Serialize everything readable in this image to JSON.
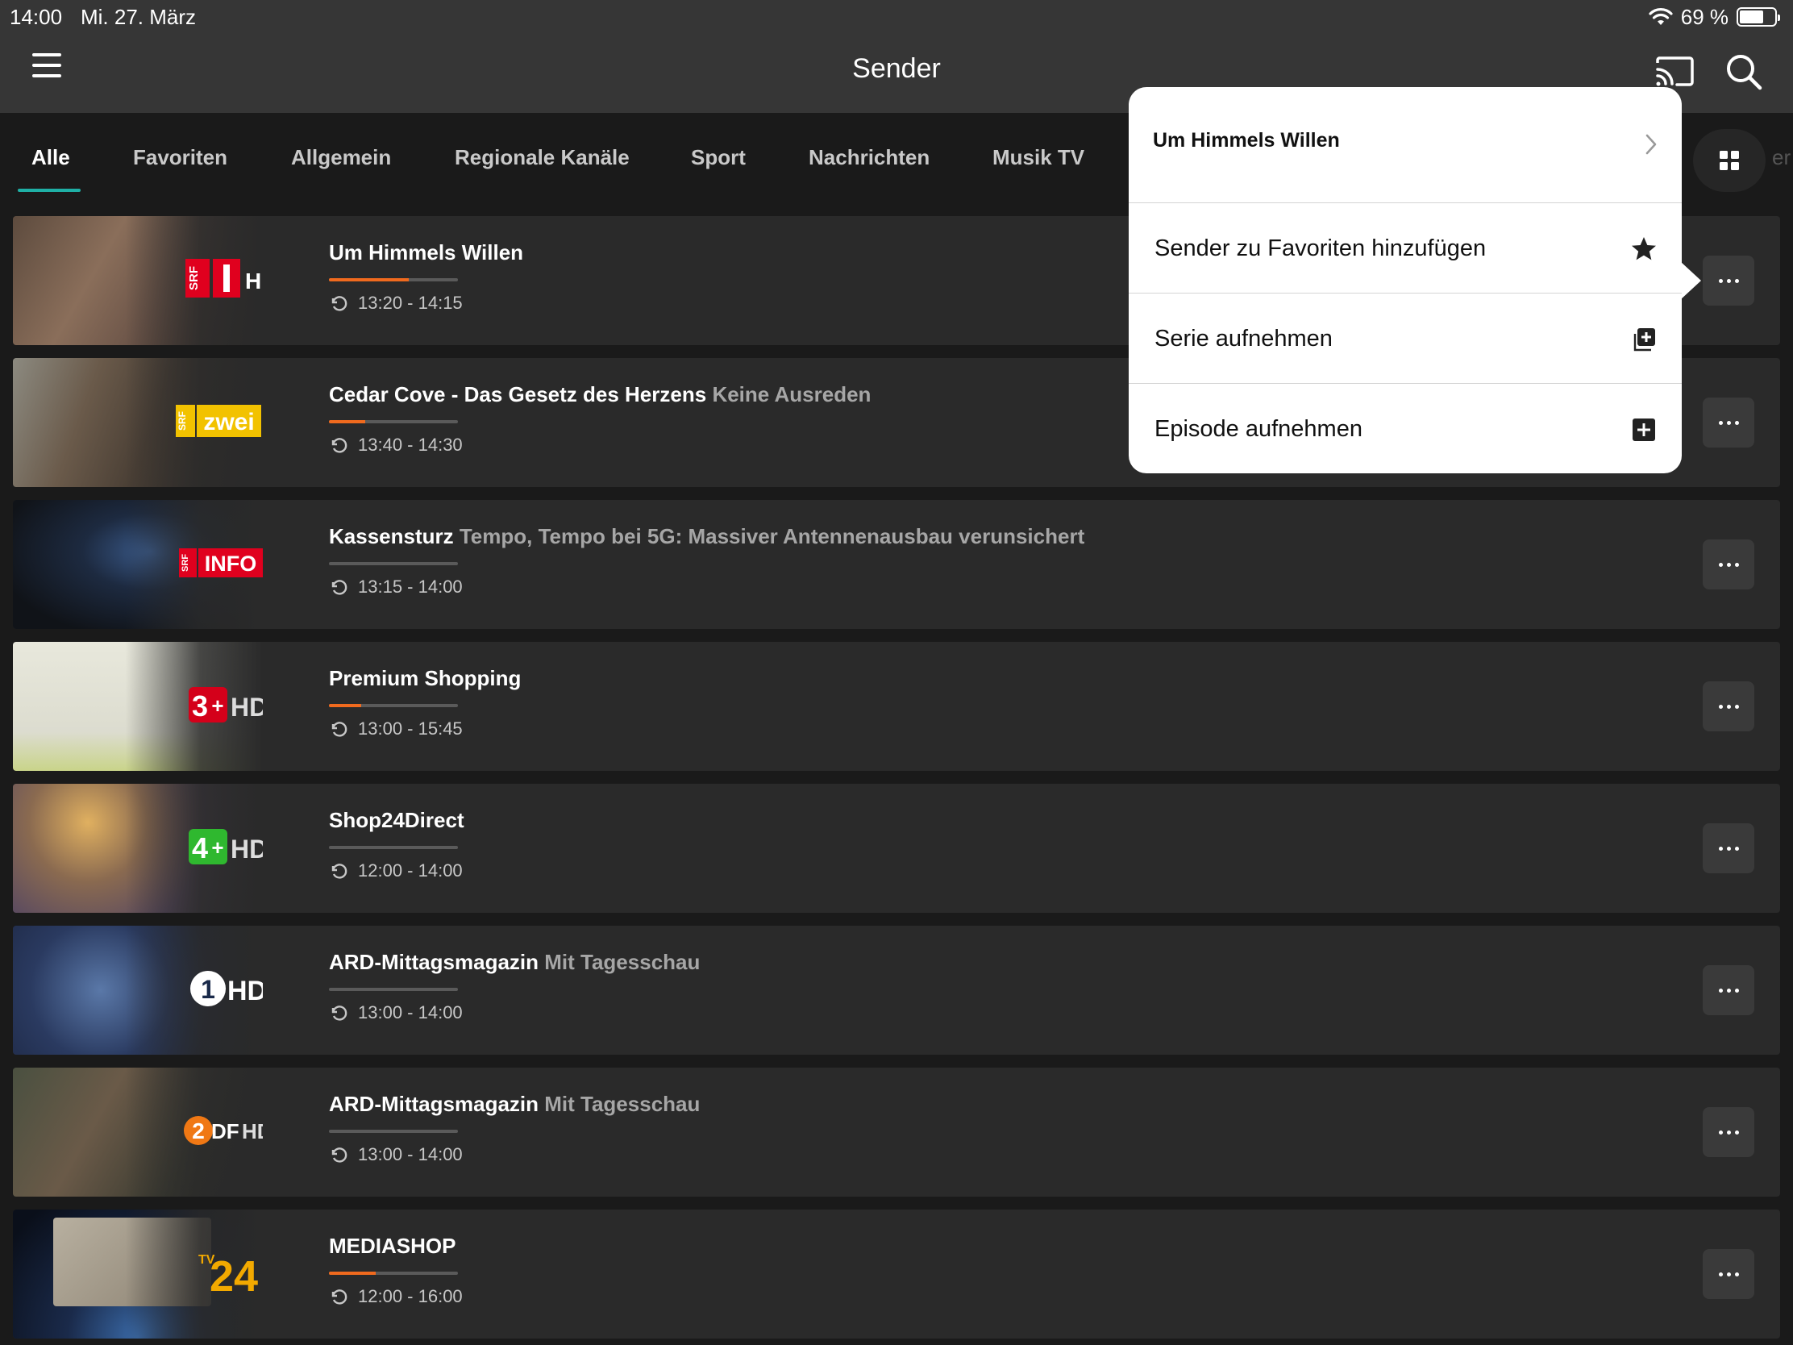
{
  "status_bar": {
    "time": "14:00",
    "date": "Mi. 27. März",
    "battery": "69 %",
    "battery_level": 0.69
  },
  "header": {
    "title": "Sender"
  },
  "tabs": [
    {
      "label": "Alle",
      "active": true
    },
    {
      "label": "Favoriten"
    },
    {
      "label": "Allgemein"
    },
    {
      "label": "Regionale Kanäle"
    },
    {
      "label": "Sport"
    },
    {
      "label": "Nachrichten"
    },
    {
      "label": "Musik TV"
    }
  ],
  "tabs_clipped": "er",
  "channels": [
    {
      "logo": "SRF 1 HD",
      "title": "Um Himmels Willen",
      "subtitle": "",
      "time": "13:20 - 14:15",
      "progress": 0.62
    },
    {
      "logo": "SRF zwei HD",
      "title": "Cedar Cove - Das Gesetz des Herzens",
      "subtitle": "Keine Ausreden",
      "time": "13:40 - 14:30",
      "progress": 0.28
    },
    {
      "logo": "SRF info HD",
      "title": "Kassensturz",
      "subtitle": "Tempo, Tempo bei 5G: Massiver Antennenausbau verunsichert",
      "time": "13:15 - 14:00",
      "progress": 0.0
    },
    {
      "logo": "3+ HD",
      "title": "Premium Shopping",
      "subtitle": "",
      "time": "13:00 - 15:45",
      "progress": 0.25
    },
    {
      "logo": "4+ HD",
      "title": "Shop24Direct",
      "subtitle": "",
      "time": "12:00 - 14:00",
      "progress": 0.0
    },
    {
      "logo": "1 HD",
      "title": "ARD-Mittagsmagazin",
      "subtitle": "Mit Tagesschau",
      "time": "13:00 - 14:00",
      "progress": 0.0
    },
    {
      "logo": "2DF HD",
      "title": "ARD-Mittagsmagazin",
      "subtitle": "Mit Tagesschau",
      "time": "13:00 - 14:00",
      "progress": 0.0
    },
    {
      "logo": "TV24",
      "title": "MEDIASHOP",
      "subtitle": "",
      "time": "12:00 - 16:00",
      "progress": 0.36
    }
  ],
  "popover": {
    "header": "Um Himmels Willen",
    "items": [
      {
        "label": "Sender zu Favoriten hinzufügen",
        "icon": "star-icon"
      },
      {
        "label": "Serie aufnehmen",
        "icon": "record-series-icon"
      },
      {
        "label": "Episode aufnehmen",
        "icon": "record-episode-icon"
      }
    ]
  },
  "colors": {
    "accent": "#1fb0a6",
    "progress": "#f06a1e",
    "srf_red": "#e0001e"
  }
}
